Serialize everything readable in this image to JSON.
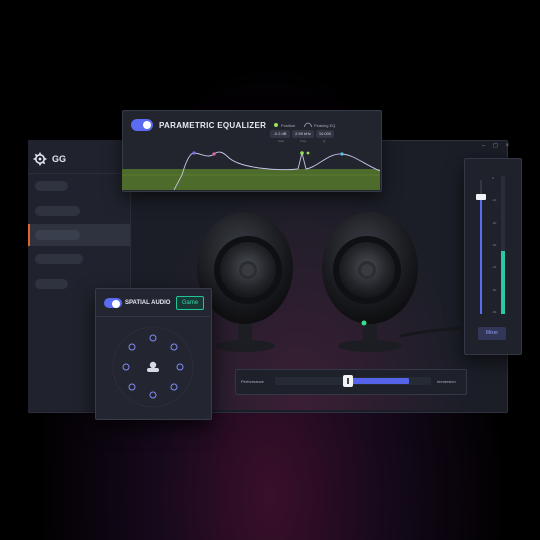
{
  "app": {
    "title": "GG",
    "logo_icon": "steelseries-gear-icon",
    "window_controls": "– ◻ ×"
  },
  "sidebar": {
    "items": [
      "",
      "",
      "",
      "",
      ""
    ],
    "active_index": 2,
    "accent": "#e5632b"
  },
  "equalizer": {
    "title": "PARAMETRIC EQUALIZER",
    "enabled": true,
    "legend": [
      {
        "label": "Position",
        "color": "#9adf5a"
      },
      {
        "label": "Peaking EQ",
        "color": "#a6abb8"
      }
    ],
    "readouts": [
      {
        "value": "-0.2 dB",
        "label": "Gain"
      },
      {
        "value": "2.99 kHz",
        "label": "Freq"
      },
      {
        "value": "10.000",
        "label": "Q"
      }
    ],
    "fill_color": "#4d6b2a",
    "curve_color": "#c9c3e8"
  },
  "mixer": {
    "button_label": "Mixer",
    "ticks": [
      "0",
      "-10",
      "-20",
      "-30",
      "-40",
      "-50",
      "-60"
    ],
    "volume_level": 0.87,
    "meter_level": 0.46,
    "meter_color": "#2ec7a4"
  },
  "spatial_audio": {
    "title": "SPATIAL AUDIO",
    "enabled": true,
    "mode_label": "Game",
    "accent": "#36d4a8"
  },
  "performance": {
    "left_label": "Performance",
    "right_label": "Immersion",
    "value": 0.5
  }
}
